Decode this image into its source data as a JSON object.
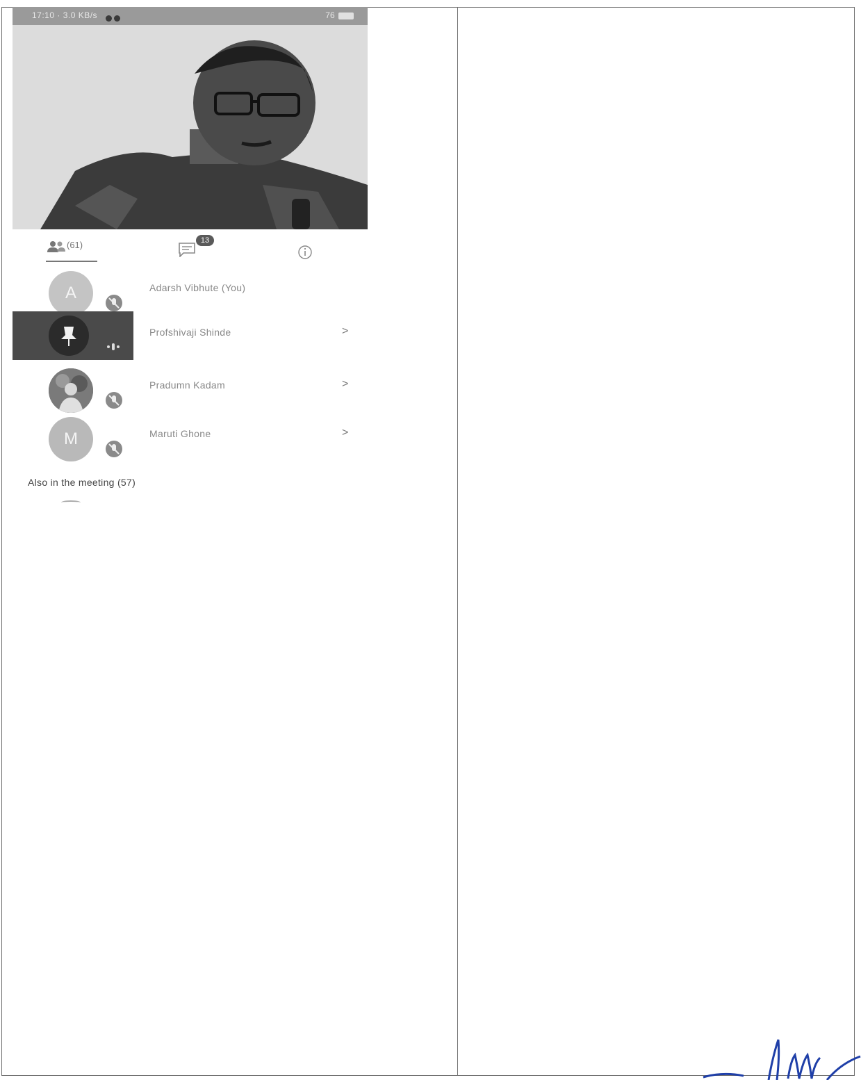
{
  "status_bar": {
    "time": "17:10 · 3.0 KB/s",
    "right": "76"
  },
  "tabs": {
    "people_count": "(61)",
    "chat_badge": "13"
  },
  "participants": [
    {
      "name": "Adarsh Vibhute (You)",
      "avatar_letter": "A",
      "avatar_kind": "letter",
      "muted": true,
      "has_chevron": false
    },
    {
      "name": "Profshivaji Shinde",
      "avatar_kind": "pin",
      "muted": false,
      "speaking": true,
      "has_chevron": true,
      "chevron": ">"
    },
    {
      "name": "Pradumn Kadam",
      "avatar_kind": "photo",
      "muted": true,
      "has_chevron": true,
      "chevron": ">"
    },
    {
      "name": "Maruti Ghone",
      "avatar_letter": "M",
      "avatar_kind": "letter",
      "muted": true,
      "has_chevron": true,
      "chevron": ">"
    }
  ],
  "also_in_meeting": "Also in the meeting (57)",
  "colors": {
    "highlight_row": "#4a4a4a",
    "avatar_bg": "#c4c4c4",
    "signature_ink": "#1f3fa8"
  }
}
